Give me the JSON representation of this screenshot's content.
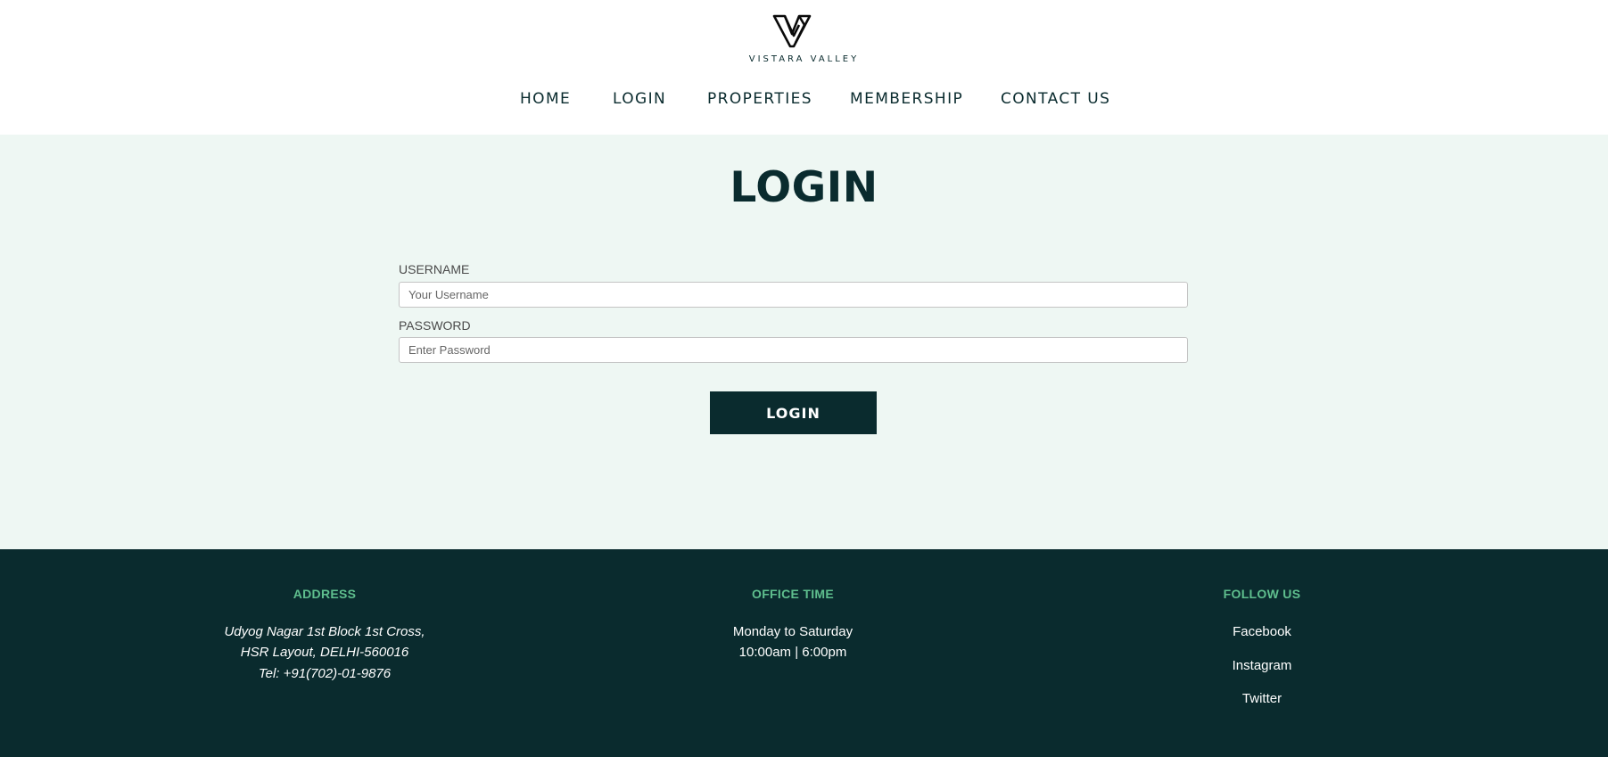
{
  "brand": {
    "name": "VISTARA VALLEY",
    "logo": "v-logo-icon"
  },
  "nav": {
    "items": [
      {
        "label": "HOME"
      },
      {
        "label": "LOGIN"
      },
      {
        "label": "PROPERTIES"
      },
      {
        "label": "MEMBERSHIP"
      },
      {
        "label": "CONTACT US"
      }
    ]
  },
  "login": {
    "title": "LOGIN",
    "username_label": "USERNAME",
    "username_placeholder": "Your Username",
    "password_label": "PASSWORD",
    "password_placeholder": "Enter Password",
    "submit_label": "LOGIN"
  },
  "footer": {
    "address": {
      "title": "ADDRESS",
      "lines": [
        "Udyog Nagar 1st Block 1st Cross,",
        "HSR Layout, DELHI-560016",
        "Tel: +91(702)-01-9876"
      ]
    },
    "office": {
      "title": "OFFICE TIME",
      "lines": [
        "Monday to Saturday",
        "10:00am | 6:00pm"
      ]
    },
    "follow": {
      "title": "FOLLOW US",
      "links": [
        "Facebook",
        "Instagram",
        "Twitter"
      ]
    }
  },
  "colors": {
    "primary_dark": "#0a2b2e",
    "main_bg": "#eef7f3",
    "footer_heading": "#5fbf8e"
  }
}
